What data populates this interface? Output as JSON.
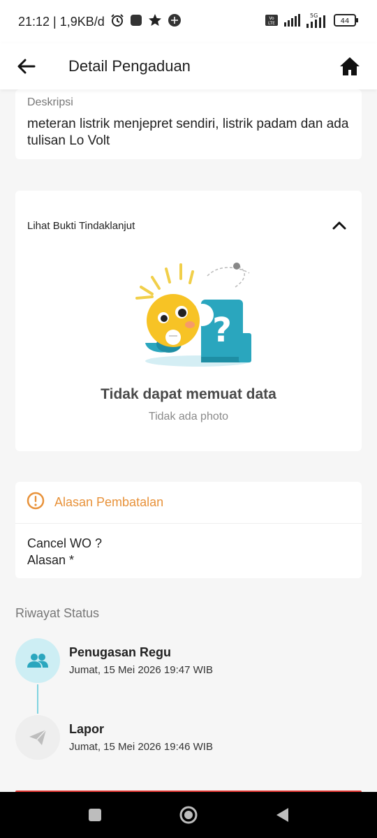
{
  "status_bar": {
    "time_info": "21:12 | 1,9KB/d",
    "battery": "44",
    "network": "5G"
  },
  "app_bar": {
    "title": "Detail Pengaduan",
    "back_icon": "arrow-left-icon",
    "home_icon": "home-icon"
  },
  "description": {
    "label": "Deskripsi",
    "text": "meteran listrik menjepret sendiri, listrik padam dan ada tulisan Lo Volt"
  },
  "proof": {
    "label": "Lihat Bukti Tindaklanjut",
    "empty_title": "Tidak dapat memuat data",
    "empty_subtitle": "Tidak ada photo"
  },
  "cancellation": {
    "title": "Alasan Pembatalan",
    "line1": "Cancel WO ?",
    "line2": "Alasan *",
    "accent_color": "#e8923a"
  },
  "history": {
    "title": "Riwayat Status",
    "items": [
      {
        "name": "Penugasan Regu",
        "date": "Jumat, 15 Mei 2026 19:47 WIB",
        "icon": "group-icon"
      },
      {
        "name": "Lapor",
        "date": "Jumat, 15 Mei 2026 19:46 WIB",
        "icon": "paper-plane-icon"
      }
    ]
  },
  "colors": {
    "primary_teal": "#2aa6be",
    "teal_light": "#cdeef4",
    "grey_light": "#eeeeee"
  }
}
